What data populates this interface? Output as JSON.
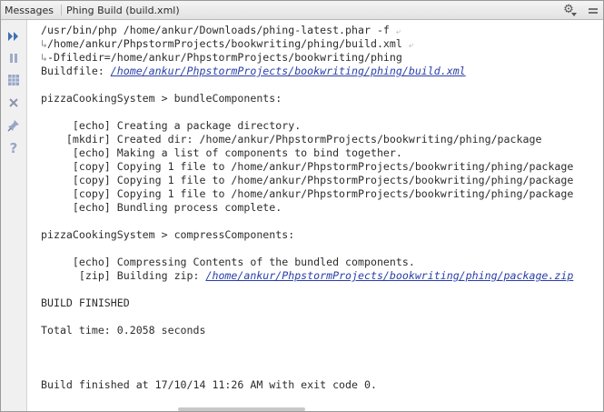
{
  "titlebar": {
    "tab_title": "Messages",
    "tab_name": "Phing Build (build.xml)",
    "settings_icon": "gear-icon",
    "hide_icon": "hide-panel-icon"
  },
  "toolbar": {
    "icons": [
      "rerun-icon",
      "pause-icon",
      "output-icon",
      "close-icon",
      "pin-icon",
      "help-icon"
    ]
  },
  "console": {
    "cmd_line_1": "/usr/bin/php /home/ankur/Downloads/phing-latest.phar -f",
    "cmd_line_2": "/home/ankur/PhpstormProjects/bookwriting/phing/build.xml",
    "cmd_line_3": "-Dfiledir=/home/ankur/PhpstormProjects/bookwriting/phing",
    "buildfile_label": "Buildfile: ",
    "buildfile_link": "/home/ankur/PhpstormProjects/bookwriting/phing/build.xml",
    "target_1": "pizzaCookingSystem > bundleComponents:",
    "bundle_lines": [
      "     [echo] Creating a package directory.",
      "    [mkdir] Created dir: /home/ankur/PhpstormProjects/bookwriting/phing/package",
      "     [echo] Making a list of components to bind together.",
      "     [copy] Copying 1 file to /home/ankur/PhpstormProjects/bookwriting/phing/package",
      "     [copy] Copying 1 file to /home/ankur/PhpstormProjects/bookwriting/phing/package",
      "     [copy] Copying 1 file to /home/ankur/PhpstormProjects/bookwriting/phing/package",
      "     [echo] Bundling process complete."
    ],
    "target_2": "pizzaCookingSystem > compressComponents:",
    "compress_echo": "     [echo] Compressing Contents of the bundled components.",
    "zip_prefix": "      [zip] Building zip: ",
    "zip_link": "/home/ankur/PhpstormProjects/bookwriting/phing/package.zip",
    "build_finished": "BUILD FINISHED",
    "total_time": "Total time: 0.2058 seconds",
    "final_status": "Build finished at 17/10/14 11:26 AM with exit code 0."
  }
}
